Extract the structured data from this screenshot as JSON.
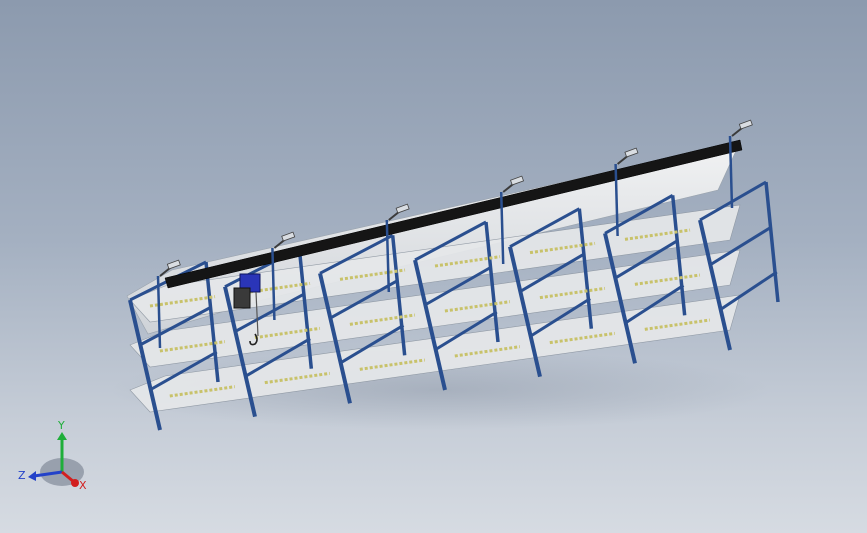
{
  "viewport": {
    "background_top": "#8c9aae",
    "background_bottom": "#d6dbe2"
  },
  "model": {
    "frame_color": "#2a4f8f",
    "deck_color": "#e6e8ea",
    "beam_color": "#1a1a1a",
    "rail_color": "#c8c26a",
    "hoist_color": "#2a35b8"
  },
  "triad": {
    "x_label": "X",
    "y_label": "Y",
    "z_label": "Z",
    "x_color": "#d21f1f",
    "y_color": "#1fae3a",
    "z_color": "#2342c9"
  }
}
